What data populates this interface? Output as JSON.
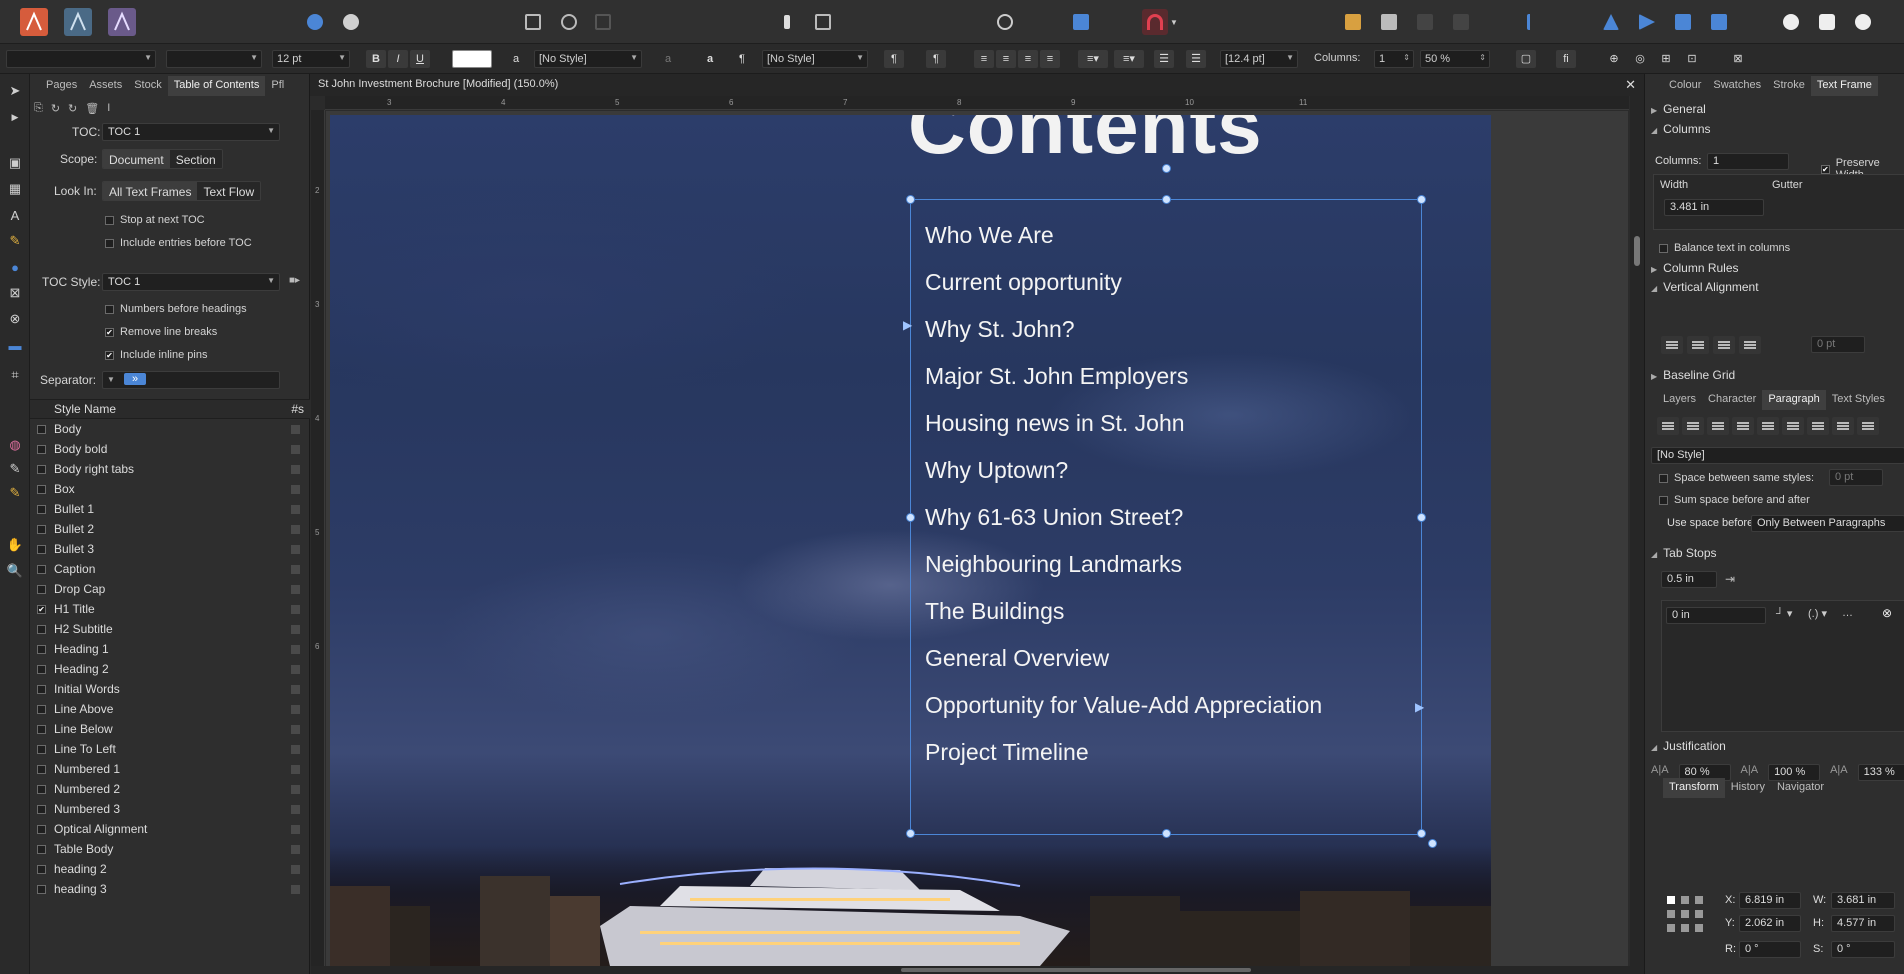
{
  "top_toolbar": {
    "personas": [
      "publisher-persona-icon",
      "designer-persona-icon",
      "photo-persona-icon"
    ]
  },
  "context_toolbar": {
    "font_family": "",
    "font_style": "",
    "font_size": "12 pt",
    "bold": "B",
    "italic": "I",
    "underline": "U",
    "char_style": "[No Style]",
    "para_style": "[No Style]",
    "leading": "[12.4 pt]",
    "columns_label": "Columns:",
    "columns_value": "1",
    "opacity": "50 %"
  },
  "left_panel": {
    "tabs": [
      "Pages",
      "Assets",
      "Stock",
      "Table of Contents",
      "Pfl"
    ],
    "active_tab": "Table of Contents",
    "toc_label": "TOC:",
    "toc_value": "TOC 1",
    "scope_label": "Scope:",
    "scope_options": [
      "Document",
      "Section"
    ],
    "look_in_label": "Look In:",
    "look_in_options": [
      "All Text Frames",
      "Text Flow"
    ],
    "stop_next": "Stop at next TOC",
    "include_before": "Include entries before TOC",
    "toc_style_label": "TOC Style:",
    "toc_style_value": "TOC 1",
    "numbers_before": "Numbers before headings",
    "remove_breaks": "Remove line breaks",
    "include_pins": "Include inline pins",
    "separator_label": "Separator:",
    "separator_value": "»",
    "style_header": "Style Name",
    "count_header": "#s",
    "styles": [
      {
        "name": "Body",
        "checked": false
      },
      {
        "name": "Body bold",
        "checked": false
      },
      {
        "name": "Body right tabs",
        "checked": false
      },
      {
        "name": "Box",
        "checked": false
      },
      {
        "name": "Bullet 1",
        "checked": false
      },
      {
        "name": "Bullet 2",
        "checked": false
      },
      {
        "name": "Bullet 3",
        "checked": false
      },
      {
        "name": "Caption",
        "checked": false
      },
      {
        "name": "Drop Cap",
        "checked": false
      },
      {
        "name": "H1 Title",
        "checked": true
      },
      {
        "name": "H2 Subtitle",
        "checked": false
      },
      {
        "name": "Heading 1",
        "checked": false
      },
      {
        "name": "Heading 2",
        "checked": false
      },
      {
        "name": "Initial Words",
        "checked": false
      },
      {
        "name": "Line Above",
        "checked": false
      },
      {
        "name": "Line Below",
        "checked": false
      },
      {
        "name": "Line To Left",
        "checked": false
      },
      {
        "name": "Numbered 1",
        "checked": false
      },
      {
        "name": "Numbered 2",
        "checked": false
      },
      {
        "name": "Numbered 3",
        "checked": false
      },
      {
        "name": "Optical Alignment",
        "checked": false
      },
      {
        "name": "Table Body",
        "checked": false
      },
      {
        "name": "heading 2",
        "checked": false
      },
      {
        "name": "heading 3",
        "checked": false
      }
    ]
  },
  "document": {
    "title": "St John Investment Brochure [Modified] (150.0%)",
    "ruler_top": [
      "3",
      "4",
      "5",
      "6",
      "7",
      "8",
      "9",
      "10",
      "11"
    ],
    "ruler_left": [
      "2",
      "3",
      "4",
      "5",
      "6"
    ],
    "heading": "Contents",
    "toc_entries": [
      "Who We Are",
      "Current opportunity",
      "Why St. John?",
      "Major St. John Employers",
      "Housing news in St. John",
      "Why Uptown?",
      "Why 61-63 Union Street?",
      "Neighbouring Landmarks",
      "The Buildings",
      "General Overview",
      "Opportunity for Value-Add Appreciation",
      "Project Timeline"
    ]
  },
  "right_panel": {
    "top_tabs": [
      "Colour",
      "Swatches",
      "Stroke",
      "Text Frame"
    ],
    "active_top_tab": "Text Frame",
    "general": "General",
    "columns_section": "Columns",
    "columns_label": "Columns:",
    "columns_value": "1",
    "preserve_width": "Preserve Width",
    "width_header": "Width",
    "gutter_header": "Gutter",
    "width_value": "3.481 in",
    "balance": "Balance text in columns",
    "column_rules": "Column Rules",
    "vertical_alignment": "Vertical Alignment",
    "valign_value": "0 pt",
    "baseline_grid": "Baseline Grid",
    "mid_tabs": [
      "Layers",
      "Character",
      "Paragraph",
      "Text Styles"
    ],
    "active_mid_tab": "Paragraph",
    "para_style": "[No Style]",
    "space_same": "Space between same styles:",
    "space_same_value": "0 pt",
    "sum_space": "Sum space before and after",
    "use_space_label": "Use space before:",
    "use_space_value": "Only Between Paragraphs",
    "tab_stops": "Tab Stops",
    "tab_default": "0.5 in",
    "tab_position": "0 in",
    "justification": "Justification",
    "just_values": [
      "80 %",
      "100 %",
      "133 %"
    ],
    "bottom_tabs": [
      "Transform",
      "History",
      "Navigator"
    ],
    "active_bottom_tab": "Transform",
    "x_label": "X:",
    "x_value": "6.819 in",
    "y_label": "Y:",
    "y_value": "2.062 in",
    "w_label": "W:",
    "w_value": "3.681 in",
    "h_label": "H:",
    "h_value": "4.577 in",
    "r_label": "R:",
    "r_value": "0 °",
    "s_label": "S:",
    "s_value": "0 °"
  },
  "colors": {
    "accent": "#4b86d6",
    "active_tool_red": "#c0303a"
  }
}
